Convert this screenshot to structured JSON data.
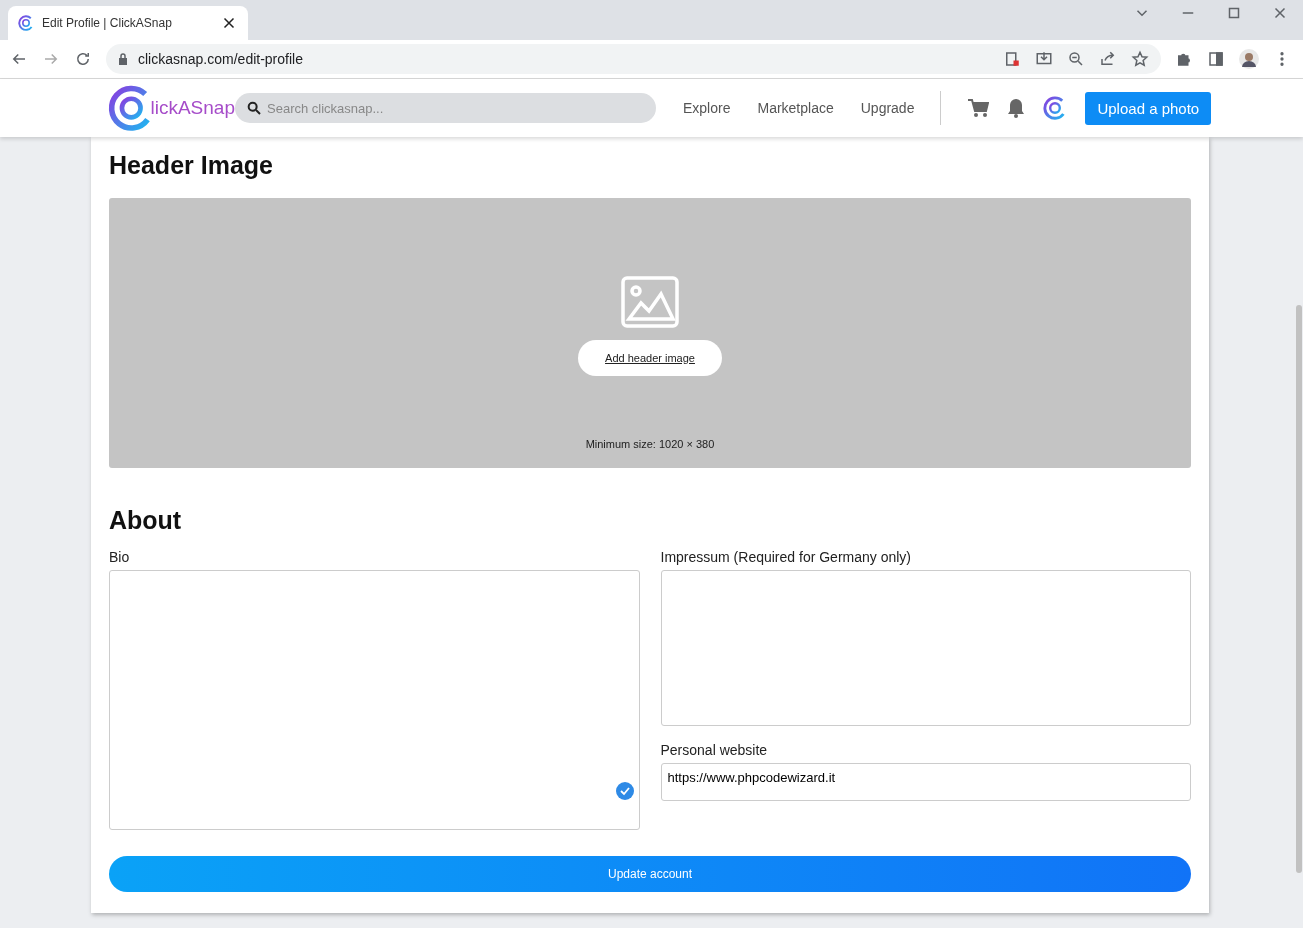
{
  "browser": {
    "tab_title": "Edit Profile | ClickASnap",
    "url": "clickasnap.com/edit-profile"
  },
  "site_header": {
    "logo_text": "lickASnap",
    "search": {
      "placeholder": "Search clickasnap..."
    },
    "nav": [
      "Explore",
      "Marketplace",
      "Upgrade"
    ],
    "upload_button": "Upload a photo"
  },
  "header_image": {
    "title": "Header Image",
    "add_button": "Add header image",
    "hint": "Minimum size: 1020 × 380"
  },
  "about": {
    "title": "About",
    "bio": {
      "label": "Bio",
      "verified": true
    },
    "impressum": {
      "label": "Impressum (Required for Germany only)"
    },
    "website": {
      "label": "Personal website",
      "value": "https://www.phpcodewizard.it"
    }
  },
  "submit_button": "Update account"
}
